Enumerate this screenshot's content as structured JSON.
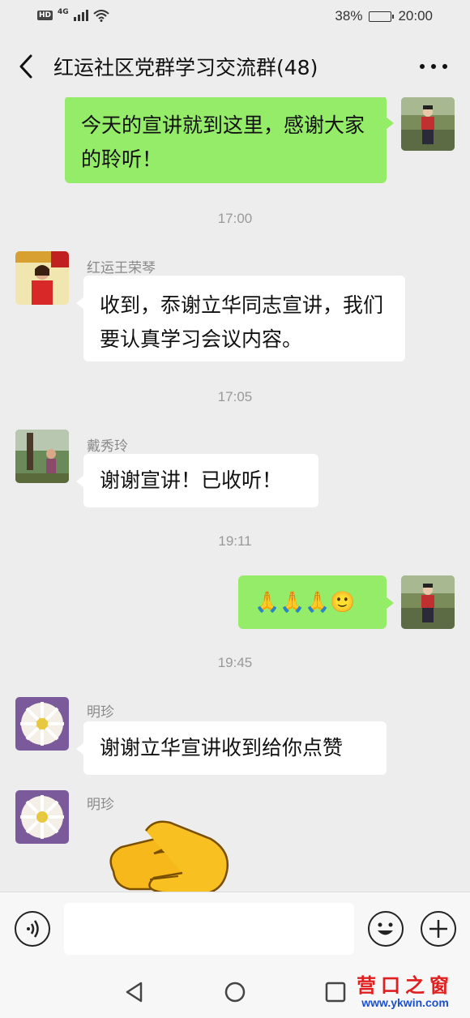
{
  "status_bar": {
    "hd": "HD",
    "network": "4G",
    "battery_percent": "38%",
    "battery_level": 0.38,
    "time": "20:00"
  },
  "header": {
    "title": "红运社区党群学习交流群(48)",
    "back_icon": "chevron-left-icon",
    "more_icon": "more-dots-icon"
  },
  "messages": [
    {
      "type": "outgoing",
      "text": "今天的宣讲就到这里，感谢大家的聆听！"
    },
    {
      "type": "time",
      "text": "17:00"
    },
    {
      "type": "incoming",
      "sender": "红运王荣琴",
      "text": "收到，忝谢立华同志宣讲，我们要认真学习会议内容。"
    },
    {
      "type": "time",
      "text": "17:05"
    },
    {
      "type": "incoming",
      "sender": "戴秀玲",
      "text": "谢谢宣讲！已收听！"
    },
    {
      "type": "time",
      "text": "19:11"
    },
    {
      "type": "outgoing",
      "text": "🙏🙏🙏🙂"
    },
    {
      "type": "time",
      "text": "19:45"
    },
    {
      "type": "incoming",
      "sender": "明珍",
      "text": "谢谢立华宣讲收到给你点赞"
    },
    {
      "type": "incoming",
      "sender": "明珍",
      "sticker": "clapping-hands-sticker"
    }
  ],
  "input_bar": {
    "voice_icon": "voice-icon",
    "emoji_icon": "emoji-icon",
    "plus_icon": "plus-icon",
    "placeholder": ""
  },
  "nav": {
    "back": "nav-back-icon",
    "home": "nav-home-icon",
    "recent": "nav-recent-icon"
  },
  "watermark": {
    "name": "营口之窗",
    "url": "www.ykwin.com"
  },
  "colors": {
    "background": "#ededed",
    "outgoing_bubble": "#95ec69",
    "incoming_bubble": "#ffffff"
  }
}
